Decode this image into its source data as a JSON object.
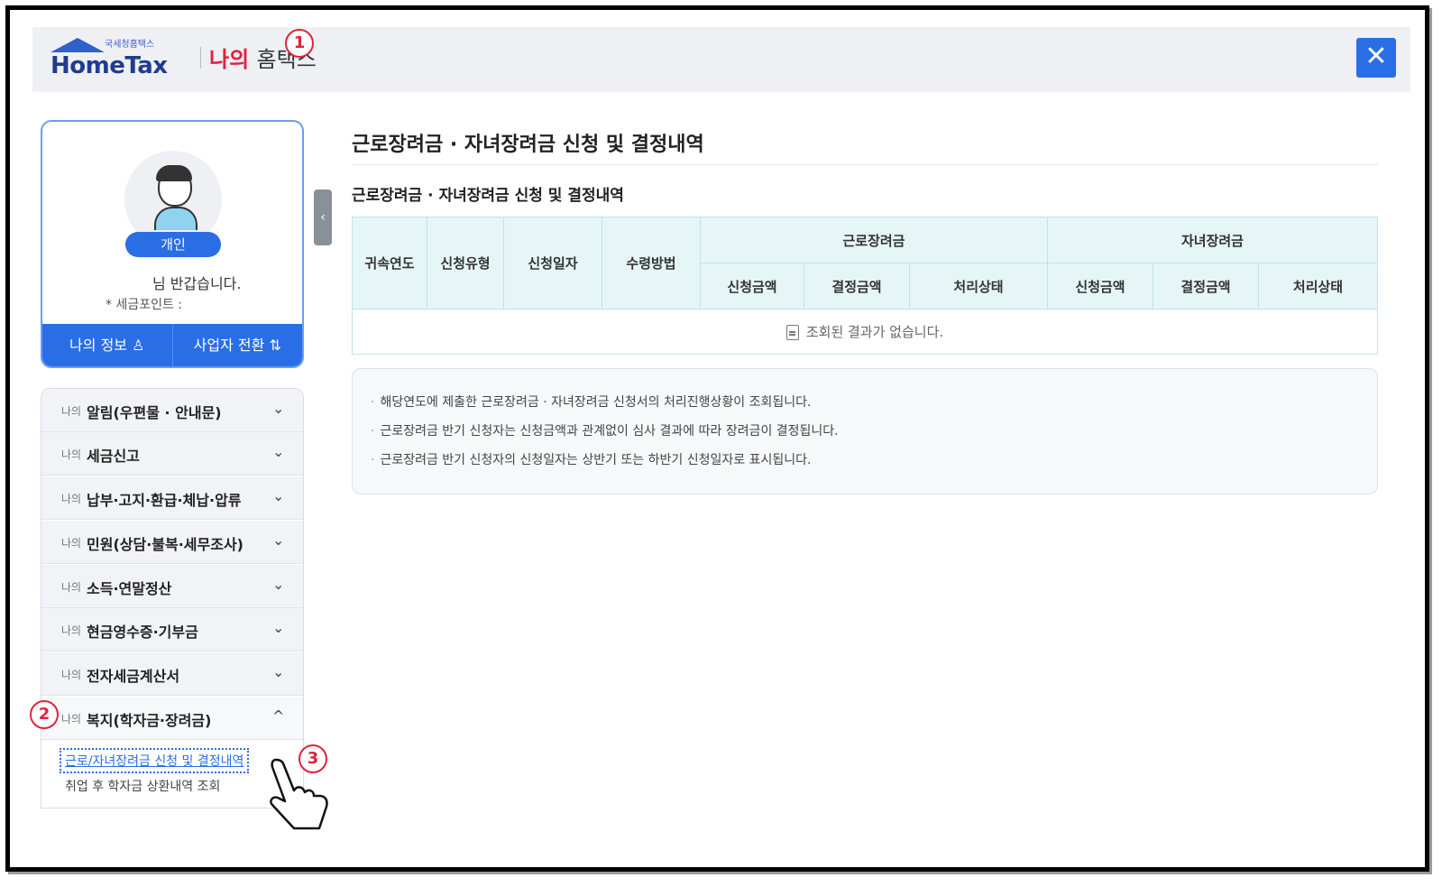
{
  "header": {
    "logo_small": "국세청홈택스",
    "logo_text": "HomeTax",
    "title_accent": "나의",
    "title_rest": "홈택스",
    "close_label": "✕"
  },
  "badges": {
    "one": "1",
    "two": "2",
    "three": "3"
  },
  "profile": {
    "type_label": "개인",
    "greeting": "님 반갑습니다.",
    "points_label": "* 세금포인트 :",
    "my_info_label": "나의 정보",
    "switch_label": "사업자 전환"
  },
  "sidebar": {
    "prefix": "나의",
    "items": [
      {
        "label": "알림(우편물 · 안내문)",
        "chevron": "⌄"
      },
      {
        "label": "세금신고",
        "chevron": "⌄"
      },
      {
        "label": "납부·고지·환급·체납·압류",
        "chevron": "⌄"
      },
      {
        "label": "민원(상담·불복·세무조사)",
        "chevron": "⌄"
      },
      {
        "label": "소득·연말정산",
        "chevron": "⌄"
      },
      {
        "label": "현금영수증·기부금",
        "chevron": "⌄"
      },
      {
        "label": "전자세금계산서",
        "chevron": "⌄"
      },
      {
        "label": "복지(학자금·장려금)",
        "chevron": "^"
      }
    ],
    "sub_items": [
      {
        "label": "근로/자녀장려금 신청 및 결정내역"
      },
      {
        "label": "취업 후 학자금 상환내역 조회"
      }
    ]
  },
  "main": {
    "title": "근로장려금 · 자녀장려금 신청 및 결정내역",
    "section_title": "근로장려금 · 자녀장려금 신청 및 결정내역",
    "table": {
      "headers": [
        "귀속연도",
        "신청유형",
        "신청일자",
        "수령방법"
      ],
      "group_work": "근로장려금",
      "group_child": "자녀장려금",
      "sub_headers": [
        "신청금액",
        "결정금액",
        "처리상태"
      ],
      "empty_message": "조회된 결과가 없습니다."
    },
    "notices": [
      "해당연도에 제출한 근로장려금 · 자녀장려금 신청서의 처리진행상황이 조회됩니다.",
      "근로장려금 반기 신청자는 신청금액과 관계없이 심사 결과에 따라 장려금이 결정됩니다.",
      "근로장려금 반기 신청자의 신청일자는 상반기 또는 하반기 신청일자로 표시됩니다."
    ]
  },
  "colors": {
    "accent": "#2a6ee6",
    "brand_red": "#e0223a",
    "table_header": "#e6f6f6"
  }
}
